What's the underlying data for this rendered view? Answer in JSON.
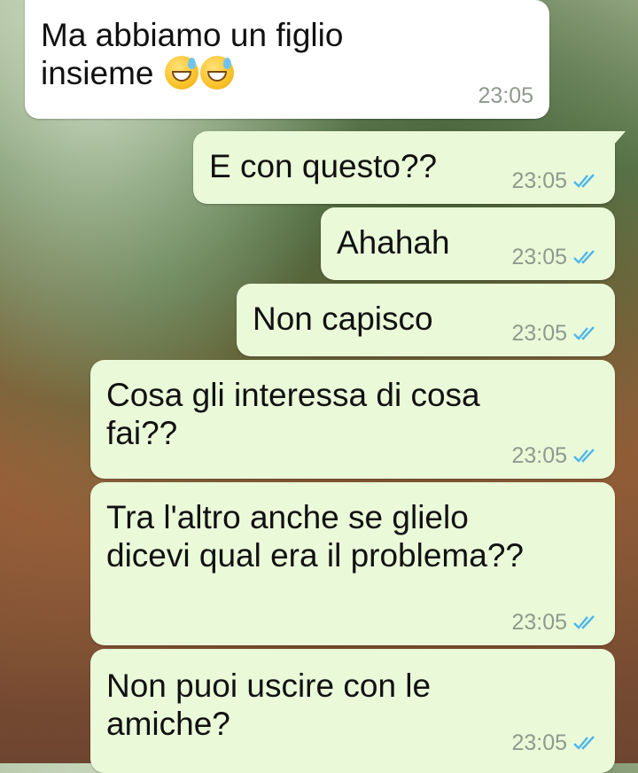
{
  "messages": [
    {
      "direction": "incoming",
      "text_line1": "Ma abbiamo un figlio",
      "text_line2": "insieme",
      "emoji": [
        "grinning-sweat-emoji",
        "grinning-sweat-emoji"
      ],
      "time": "23:05"
    },
    {
      "direction": "outgoing",
      "text": "E con questo??",
      "time": "23:05",
      "status": "read"
    },
    {
      "direction": "outgoing",
      "text": "Ahahah",
      "time": "23:05",
      "status": "read"
    },
    {
      "direction": "outgoing",
      "text": "Non capisco",
      "time": "23:05",
      "status": "read"
    },
    {
      "direction": "outgoing",
      "text_line1": "Cosa gli interessa di cosa",
      "text_line2": "fai??",
      "time": "23:05",
      "status": "read"
    },
    {
      "direction": "outgoing",
      "text_line1": "Tra l'altro anche se glielo",
      "text_line2": "dicevi qual era il problema??",
      "time": "23:05",
      "status": "read"
    },
    {
      "direction": "outgoing",
      "text_line1": "Non puoi uscire con le",
      "text_line2": "amiche?",
      "time": "23:05",
      "status": "read"
    }
  ],
  "colors": {
    "incoming_bubble": "#ffffff",
    "outgoing_bubble": "#eafad9",
    "timestamp": "#8e9a8c",
    "read_ticks": "#4fb6ec"
  }
}
